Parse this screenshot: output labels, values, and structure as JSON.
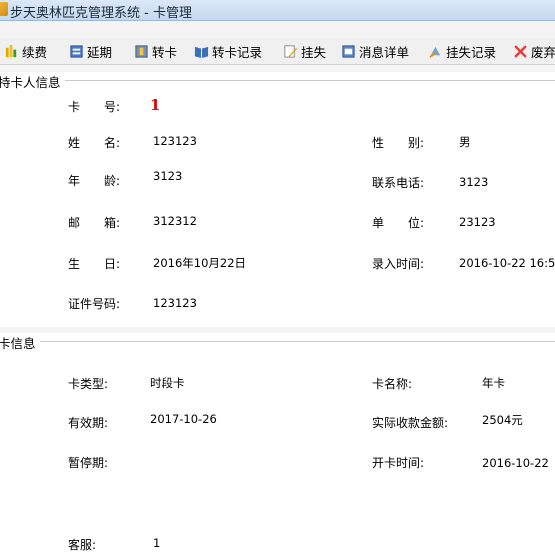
{
  "window": {
    "title": "步天奥林匹克管理系统 - 卡管理"
  },
  "toolbar": {
    "renew": "续费",
    "extend": "延期",
    "transfer": "转卡",
    "transfer_log": "转卡记录",
    "report_loss": "挂失",
    "message_detail": "消息详单",
    "loss_log": "挂失记录",
    "void": "废弃"
  },
  "holder": {
    "section_title": "持卡人信息",
    "card_no_label": "卡　　号:",
    "card_no": "1",
    "name_label": "姓　　名:",
    "name": "123123",
    "gender_label": "性　　别:",
    "gender": "男",
    "age_label": "年　　龄:",
    "age": "3123",
    "phone_label": "联系电话:",
    "phone": "3123",
    "email_label": "邮　　箱:",
    "email": "312312",
    "unit_label": "单　　位:",
    "unit": "23123",
    "birthday_label": "生　　日:",
    "birthday": "2016年10月22日",
    "entry_time_label": "录入时间:",
    "entry_time": "2016-10-22 16:5",
    "id_no_label": "证件号码:",
    "id_no": "123123"
  },
  "card": {
    "section_title": "卡信息",
    "type_label": "卡类型:",
    "type": "时段卡",
    "name_label": "卡名称:",
    "name": "年卡",
    "valid_label": "有效期:",
    "valid": "2017-10-26",
    "paid_label": "实际收款金额:",
    "paid": "2504元",
    "suspend_label": "暂停期:",
    "suspend": "",
    "open_time_label": "开卡时间:",
    "open_time": "2016-10-22",
    "service_label": "客服:",
    "service": "1"
  },
  "colors": {
    "accent": "#e00000",
    "titlebar": "#c5d8ee"
  },
  "icons": [
    "app-icon",
    "renew-icon",
    "extend-icon",
    "transfer-icon",
    "book-icon",
    "pencil-icon",
    "message-icon",
    "loss-log-icon",
    "delete-icon"
  ]
}
